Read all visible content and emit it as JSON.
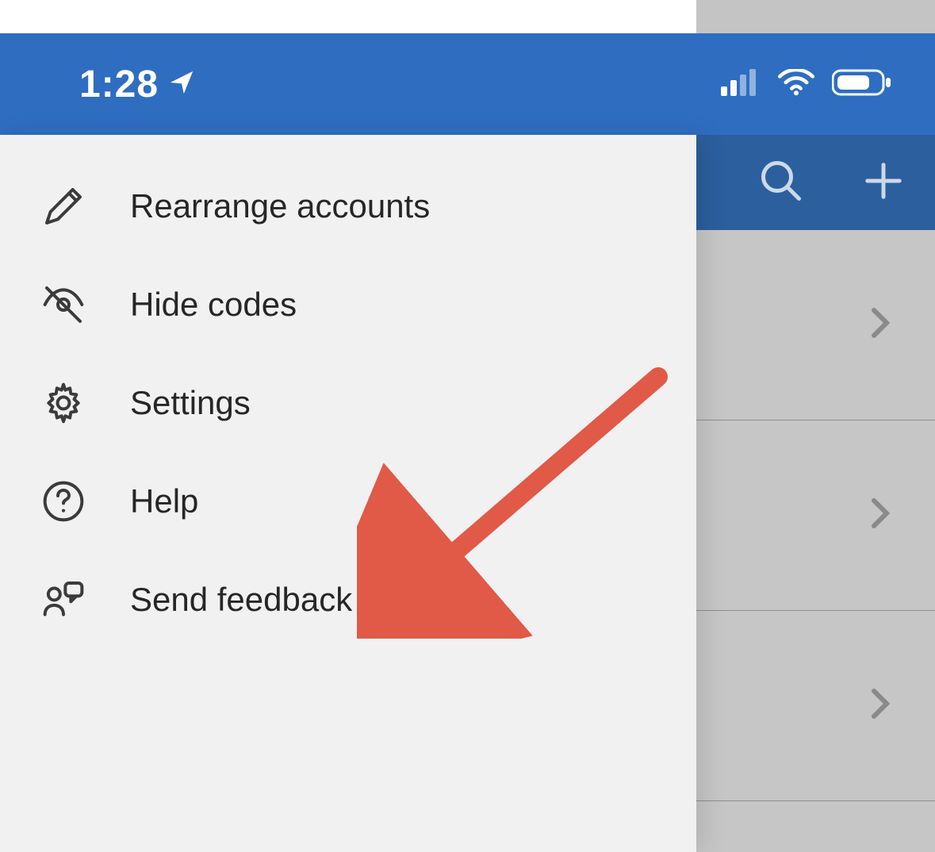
{
  "colors": {
    "status_bar_bg": "#2f6dc1",
    "app_bar_bg": "#2c5f9e",
    "drawer_bg": "#f1f1f1",
    "text": "#262626",
    "arrow": "#e05a47"
  },
  "status_bar": {
    "time": "1:28",
    "location_arrow": true,
    "signal_bars": 3,
    "wifi": true,
    "battery": true
  },
  "app_bar_background_icons": {
    "search": "search",
    "add": "add"
  },
  "drawer": {
    "items": [
      {
        "icon": "edit-icon",
        "label": "Rearrange accounts"
      },
      {
        "icon": "hide-icon",
        "label": "Hide codes"
      },
      {
        "icon": "settings-icon",
        "label": "Settings"
      },
      {
        "icon": "help-icon",
        "label": "Help"
      },
      {
        "icon": "feedback-icon",
        "label": "Send feedback"
      }
    ]
  },
  "annotation": {
    "target_item_index": 4,
    "description": "arrow pointing to Send feedback"
  },
  "background_list_row_count": 3
}
